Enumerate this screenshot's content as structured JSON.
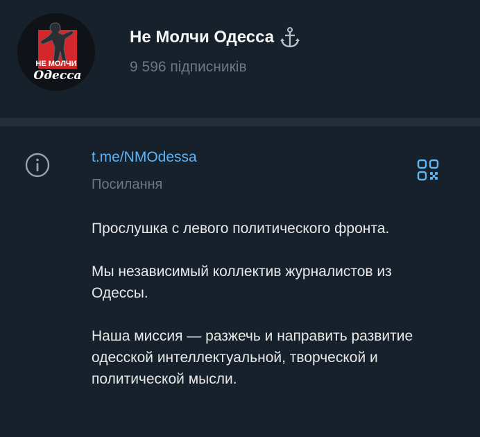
{
  "channel": {
    "name": "Не Молчи Одесса",
    "subscribers": "9 596 підписників",
    "avatar_text_top": "НЕ МОЛЧИ",
    "avatar_text_bottom": "Одесса"
  },
  "info": {
    "link": "t.me/NMOdessa",
    "link_caption": "Посилання",
    "description": [
      "Прослушка с левого политического фронта.",
      "Мы независимый коллектив журналистов из Одессы.",
      "Наша миссия — разжечь и направить развитие одесской интеллектуальной, творческой и политической мысли."
    ]
  },
  "icons": {
    "info": "info-icon",
    "qr": "qr-code-icon",
    "anchor": "anchor-icon"
  },
  "colors": {
    "background": "#17212b",
    "divider": "#232e3c",
    "accent_link": "#5eb5f7",
    "muted_text": "#6d7883",
    "primary_text": "#e8e8e8",
    "avatar_red": "#d3272b"
  }
}
